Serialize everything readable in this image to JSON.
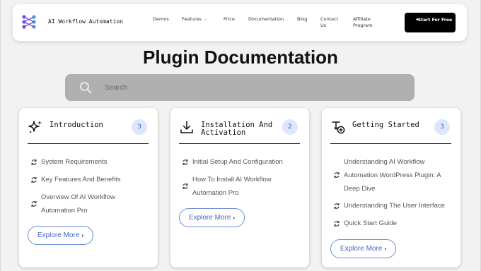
{
  "header": {
    "logo_text": "AI Workflow Automation",
    "nav": {
      "demos": "Demos",
      "features": "Features",
      "price": "Price",
      "documentation": "Documentation",
      "blog": "Blog",
      "contact": "Contact Us",
      "affiliate": "Affiliate Program"
    },
    "cta": "Start For Free"
  },
  "main": {
    "title": "Plugin Documentation",
    "search": {
      "placeholder": "Search"
    },
    "explore_label": "Explore More",
    "cards": [
      {
        "title": "Introduction",
        "count": "3",
        "icon": "sparkle-icon",
        "items": [
          "System Requirements",
          "Key Features And Benefits",
          "Overview Of AI Workflow Automation Pro"
        ]
      },
      {
        "title": "Installation And Activation",
        "count": "2",
        "icon": "download-icon",
        "items": [
          "Initial Setup And Configuration",
          "How To Install AI Workflow Automation Pro"
        ]
      },
      {
        "title": "Getting Started",
        "count": "3",
        "icon": "flow-add-icon",
        "items": [
          "Understanding AI Workflow Automation WordPress Plugin: A Deep Dive",
          "Understanding The User Interface",
          "Quick Start Guide"
        ]
      }
    ]
  },
  "colors": {
    "accent": "#4466c8",
    "badge_bg": "#dce7fb",
    "search_bg": "#b0b0b0",
    "logo_purple": "#7b4fd6",
    "logo_blue": "#4aa3e8"
  }
}
